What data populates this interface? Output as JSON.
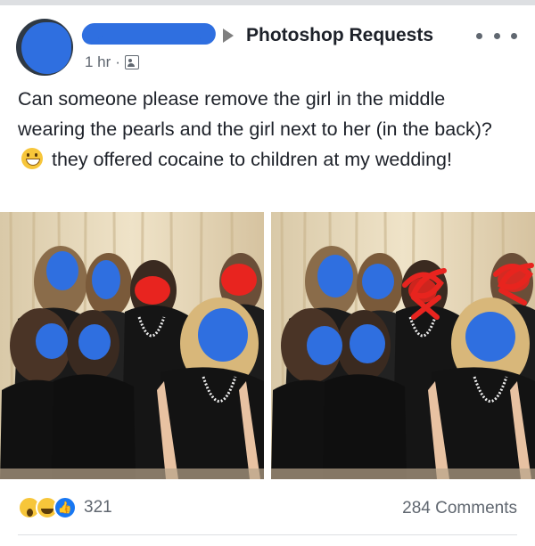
{
  "post": {
    "group_name": "Photoshop Requests",
    "time": "1 hr",
    "separator": "·",
    "audience_icon": "group-audience-icon",
    "more_icon": "more-options-icon",
    "text_part1": "Can someone please remove the girl in the middle wearing the pearls and the girl next to her (in the back)?",
    "emoji": "grinning-face-emoji",
    "text_part2": "they offered cocaine to children at my wedding!"
  },
  "photos": [
    {
      "label": "original-photo"
    },
    {
      "label": "marked-photo"
    }
  ],
  "footer": {
    "reaction_icons": [
      "wow-reaction-icon",
      "haha-reaction-icon",
      "like-reaction-icon"
    ],
    "reaction_count": "321",
    "comments": "284 Comments"
  },
  "colors": {
    "redact_blue": "#2f6fe0",
    "redact_red": "#e8241f",
    "text": "#1d2129",
    "meta": "#606770"
  }
}
